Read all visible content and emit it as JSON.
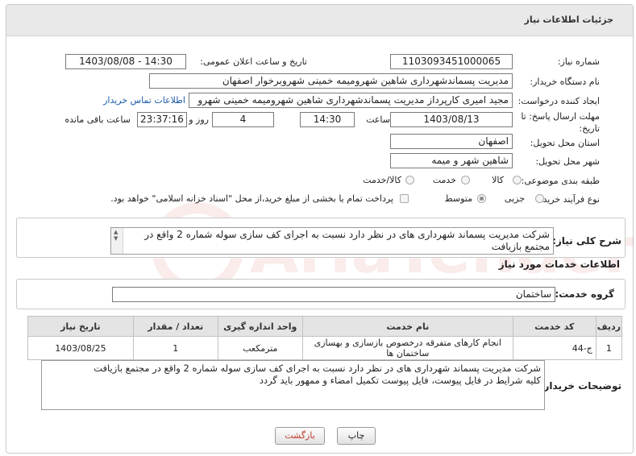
{
  "header": {
    "title": "جزئیات اطلاعات نیاز"
  },
  "need_number": {
    "label": "شماره نیاز:",
    "value": "1103093451000065"
  },
  "announce_datetime": {
    "label": "تاریخ و ساعت اعلان عمومی:",
    "value": "1403/08/08 - 14:30"
  },
  "buyer_org": {
    "label": "نام دستگاه خریدار:",
    "value": "مدیریت پسماندشهرداری شاهین شهرومیمه خمینی شهروبرخوار اصفهان"
  },
  "requester": {
    "label": "ایجاد کننده درخواست:",
    "value": "مجید امیری کارپرداز مدیریت پسماندشهرداری شاهین شهرومیمه خمینی شهرو",
    "contact_link": "اطلاعات تماس خریدار"
  },
  "deadline": {
    "label_line1": "مهلت ارسال پاسخ: تا",
    "label_line2": "تاریخ:",
    "date": "1403/08/13",
    "time_label": "ساعت",
    "time": "14:30",
    "days": "4",
    "days_label": "روز و",
    "remaining": "23:37:16",
    "remaining_label": "ساعت باقی مانده"
  },
  "province": {
    "label": "استان محل تحویل:",
    "value": "اصفهان"
  },
  "city": {
    "label": "شهر محل تحویل:",
    "value": "شاهین شهر و میمه"
  },
  "category": {
    "label": "طبقه بندی موضوعی:",
    "options": [
      "کالا",
      "خدمت",
      "کالا/خدمت"
    ],
    "selected": "خدمت"
  },
  "purchase_type": {
    "label": "نوع فرآیند خرید :",
    "options": [
      "جزیی",
      "متوسط"
    ],
    "selected": "جزیی",
    "note": "پرداخت تمام یا بخشی از مبلغ خرید،از محل \"اسناد خزانه اسلامی\" خواهد بود."
  },
  "description": {
    "label": "شرح کلی نیاز:",
    "value": "شرکت مدیریت پسماند شهرداری های  در نظر دارد نسبت به اجرای کف سازی سوله شماره 2 واقع در مجتمع بازیافت"
  },
  "services_title": "اطلاعات خدمات مورد نیاز",
  "service_group": {
    "label": "گروه خدمت:",
    "value": "ساختمان"
  },
  "table": {
    "headers": [
      "ردیف",
      "کد خدمت",
      "نام خدمت",
      "واحد اندازه گیری",
      "تعداد / مقدار",
      "تاریخ نیاز"
    ],
    "rows": [
      [
        "1",
        "ج-44",
        "انجام کارهای متفرقه درخصوص بازسازی و بهسازی ساختمان ها",
        "مترمکعب",
        "1",
        "1403/08/25"
      ]
    ]
  },
  "buyer_notes": {
    "label": "توضیحات خریدار:",
    "line1": "شرکت مدیریت پسماند شهرداری های  در نظر دارد نسبت به اجرای کف سازی سوله شماره 2 واقع در مجتمع بازیافت",
    "line2": "کلیه شرایط در فایل پیوست، فایل پیوست تکمیل امضاء و ممهور باید گردد"
  },
  "buttons": {
    "print": "چاپ",
    "back": "بازگشت"
  },
  "colors": {
    "back_button_text": "#c0392b",
    "link": "#1a5aa8",
    "header_bg": "#e9e9e9"
  }
}
